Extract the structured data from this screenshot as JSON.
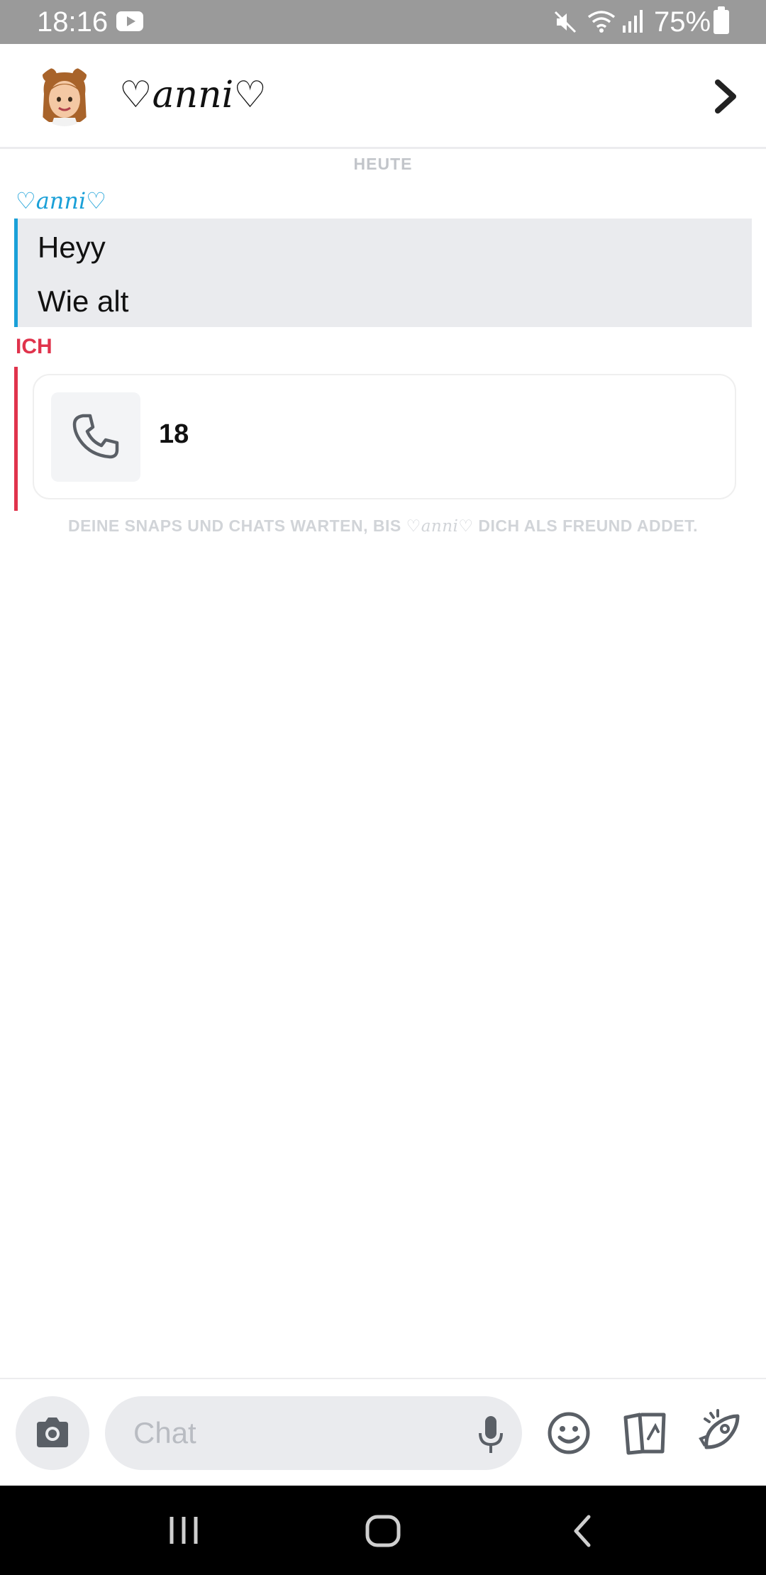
{
  "status_bar": {
    "time": "18:16",
    "battery": "75%",
    "icons": [
      "youtube-icon",
      "mute-icon",
      "wifi-icon",
      "signal-icon",
      "battery-icon"
    ]
  },
  "header": {
    "contact_name": "♡anni♡",
    "icons": [
      "avatar",
      "chevron-right-icon"
    ]
  },
  "chat": {
    "day_label": "HEUTE",
    "sender_them": "♡anni♡",
    "messages_them": [
      "Heyy",
      "Wie alt"
    ],
    "sender_me": "ICH",
    "call_text": "18",
    "notice_before": "DEINE SNAPS UND CHATS WARTEN, BIS ",
    "notice_name": "♡anni♡",
    "notice_after": " DICH ALS FREUND ADDET."
  },
  "input_bar": {
    "placeholder": "Chat",
    "icons": [
      "camera-icon",
      "mic-icon",
      "emoji-icon",
      "cards-icon",
      "rocket-icon"
    ]
  },
  "colors": {
    "them_accent": "#1aa0d8",
    "me_accent": "#e0334c",
    "status_bar_bg": "#9a9a9a",
    "bubble_bg": "#eaebee"
  },
  "nav_bar": {
    "icons": [
      "recents-icon",
      "home-icon",
      "back-icon"
    ]
  }
}
